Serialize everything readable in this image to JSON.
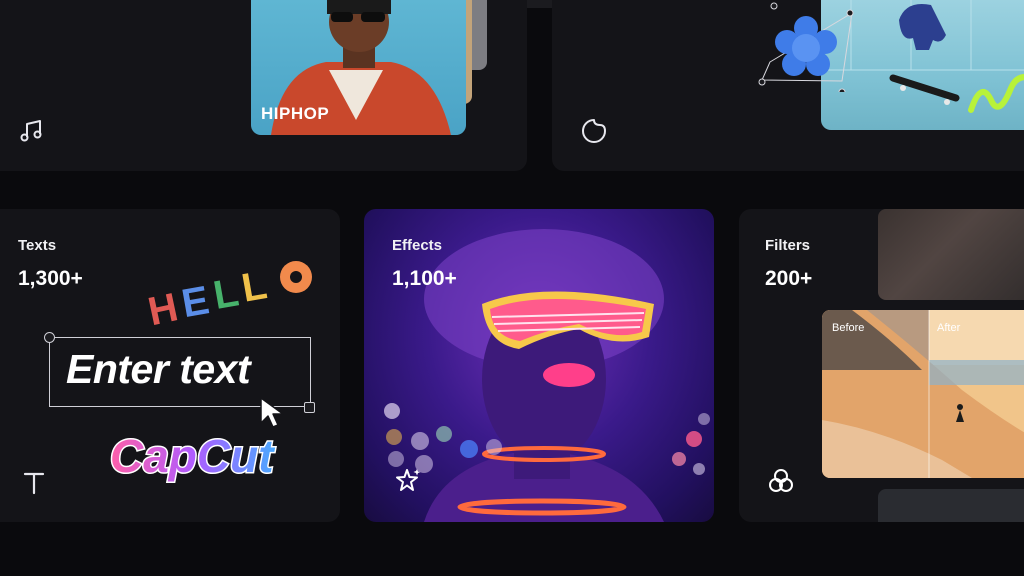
{
  "cards": {
    "music": {
      "art_label": "HIPHOP"
    },
    "texts": {
      "title": "Texts",
      "count": "1,300+",
      "sample_input": "Enter text",
      "sticker_hello": "HELLO",
      "sticker_brand": "CapCut"
    },
    "effects": {
      "title": "Effects",
      "count": "1,100+"
    },
    "filters": {
      "title": "Filters",
      "count": "200+",
      "before_label": "Before",
      "after_label": "After"
    }
  },
  "icons": {
    "music": "music-note-icon",
    "stickers": "sticker-icon",
    "texts": "text-tool-icon",
    "effects": "sparkle-star-icon",
    "filters": "filters-circles-icon"
  },
  "colors": {
    "background": "#0a0a0d",
    "card": "#141418",
    "hello_letters": [
      "#e05a54",
      "#f0c14a",
      "#47b26b",
      "#5b8ee8",
      "#f18a4c"
    ],
    "capcut_gradient": [
      "#ff5fa8",
      "#b05cff",
      "#4aa8ff"
    ],
    "accent_lime": "#b8f23a"
  }
}
